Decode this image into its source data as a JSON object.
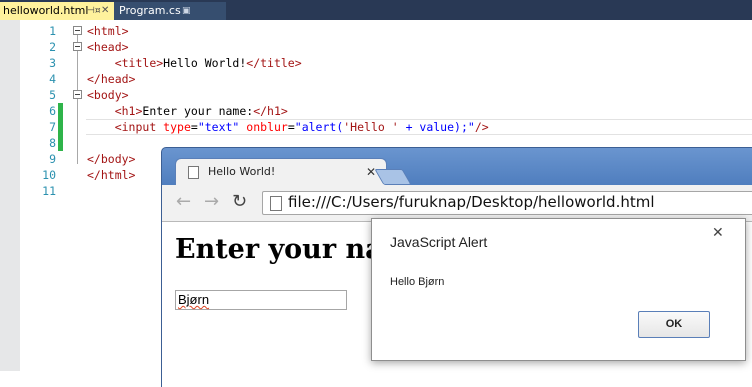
{
  "editor": {
    "tabs": [
      {
        "label": "helloworld.html",
        "active": true
      },
      {
        "label": "Program.cs",
        "active": false
      }
    ],
    "lines": [
      {
        "num": "1",
        "parts": [
          [
            "t",
            "<html>"
          ]
        ]
      },
      {
        "num": "2",
        "parts": [
          [
            "t",
            "<head>"
          ]
        ]
      },
      {
        "num": "3",
        "parts": [
          [
            "k",
            "    "
          ],
          [
            "t",
            "<title>"
          ],
          [
            "k",
            "Hello World!"
          ],
          [
            "t",
            "</title>"
          ]
        ]
      },
      {
        "num": "4",
        "parts": [
          [
            "t",
            "</head>"
          ]
        ]
      },
      {
        "num": "5",
        "parts": [
          [
            "t",
            "<body>"
          ]
        ]
      },
      {
        "num": "6",
        "parts": [
          [
            "k",
            "    "
          ],
          [
            "t",
            "<h1>"
          ],
          [
            "k",
            "Enter your name:"
          ],
          [
            "t",
            "</h1>"
          ]
        ]
      },
      {
        "num": "7",
        "parts": [
          [
            "k",
            "    "
          ],
          [
            "t",
            "<input "
          ],
          [
            "a",
            "type"
          ],
          [
            "k",
            "="
          ],
          [
            "b",
            "\"text\""
          ],
          [
            "k",
            " "
          ],
          [
            "a",
            "onblur"
          ],
          [
            "k",
            "="
          ],
          [
            "b",
            "\"alert("
          ],
          [
            "t",
            "'Hello '"
          ],
          [
            "b",
            " + value);\""
          ],
          [
            "t",
            "/>"
          ]
        ]
      },
      {
        "num": "8",
        "parts": []
      },
      {
        "num": "9",
        "parts": [
          [
            "t",
            "</body>"
          ]
        ]
      },
      {
        "num": "10",
        "parts": [
          [
            "t",
            "</html>"
          ]
        ]
      },
      {
        "num": "11",
        "parts": []
      }
    ],
    "colors": {
      "tabbar": "#293955",
      "active_tab": "#fff29d",
      "line_number": "#2b91af",
      "tag": "#a31515",
      "attribute": "#ff0000",
      "value": "#0000ff",
      "changed": "#2fb44a"
    }
  },
  "browser": {
    "tab_title": "Hello World!",
    "url": "file:///C:/Users/furuknap/Desktop/helloworld.html",
    "page_heading": "Enter your name:",
    "input_value": "Bjørn"
  },
  "alert": {
    "title": "JavaScript Alert",
    "message": "Hello Bjørn",
    "ok_label": "OK"
  }
}
